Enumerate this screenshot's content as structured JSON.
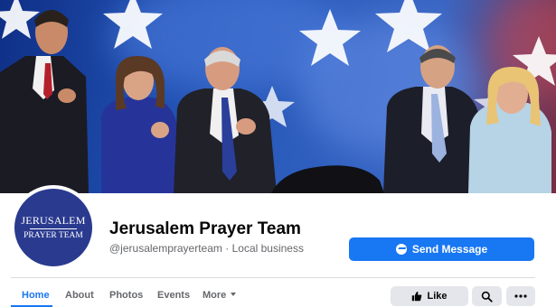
{
  "page": {
    "name": "Jerusalem Prayer Team",
    "handle": "@jerusalemprayerteam",
    "separator": "·",
    "category": "Local business"
  },
  "avatar": {
    "line1": "JERUSALEM",
    "line2": "PRAYER TEAM"
  },
  "actions": {
    "send_message": "Send Message",
    "like": "Like"
  },
  "tabs": [
    {
      "label": "Home",
      "active": true
    },
    {
      "label": "About",
      "active": false
    },
    {
      "label": "Photos",
      "active": false
    },
    {
      "label": "Events",
      "active": false
    },
    {
      "label": "More",
      "active": false
    }
  ],
  "colors": {
    "accent": "#1877f2",
    "avatar_bg": "#2a3a8f",
    "button_gray": "#e4e6eb"
  },
  "icons": [
    "messenger-icon",
    "thumbs-up-icon",
    "search-icon",
    "more-dots-icon",
    "chevron-down-icon"
  ]
}
